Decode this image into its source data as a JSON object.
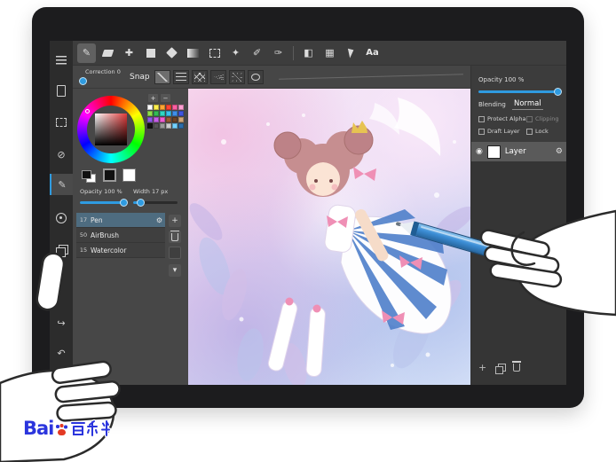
{
  "icons": {
    "pen": "✎",
    "magic_wand": "✦",
    "select_pen": "✐",
    "select_eraser": "✑",
    "move": "✚",
    "split": "◧",
    "materials": "▦",
    "none": "⊘",
    "share": "↪",
    "undo": "↶",
    "gear": "⚙",
    "eye": "◉",
    "chevron_down": "▾"
  },
  "toolbar": {
    "text_tool": "Aa"
  },
  "subbar": {
    "correction_label": "Correction 0",
    "snap_label": "Snap"
  },
  "left_panel": {
    "palette_add": "+",
    "palette_remove": "−",
    "opacity_label": "Opacity 100 %",
    "width_label": "Width 17 px",
    "brushes": [
      {
        "size": "17",
        "name": "Pen"
      },
      {
        "size": "50",
        "name": "AirBrush"
      },
      {
        "size": "15",
        "name": "Watercolor"
      }
    ],
    "brush_add": "+",
    "palette_colors": [
      "#ffffff",
      "#fff04d",
      "#ffa633",
      "#ff4433",
      "#ff5fa2",
      "#ff9ed2",
      "#8fe04a",
      "#33bb55",
      "#2fd6c3",
      "#39c2ef",
      "#3f8fe8",
      "#3f55e0",
      "#8e59e8",
      "#c75fe8",
      "#ef5fd2",
      "#9a5b33",
      "#6b4226",
      "#d2a679",
      "#111111",
      "#555555",
      "#9a9a9a",
      "#cccccc",
      "#74d2ff",
      "#2b6daa"
    ]
  },
  "right_panel": {
    "opacity_label": "Opacity 100 %",
    "blending_label": "Blending",
    "blending_value": "Normal",
    "checkboxes": [
      {
        "label": "Protect Alpha"
      },
      {
        "label": "Clipping"
      },
      {
        "label": "Draft Layer"
      },
      {
        "label": "Lock"
      }
    ],
    "layer_name": "Layer",
    "layer_add": "+"
  },
  "watermark": {
    "brand": "Bai",
    "brand_cjk": "百科"
  },
  "colors": {
    "accent": "#2f9be0",
    "stylus": "#3c8ed6",
    "brush_selection": "#4e6c80",
    "tablet_frame": "#1c1c1e"
  }
}
